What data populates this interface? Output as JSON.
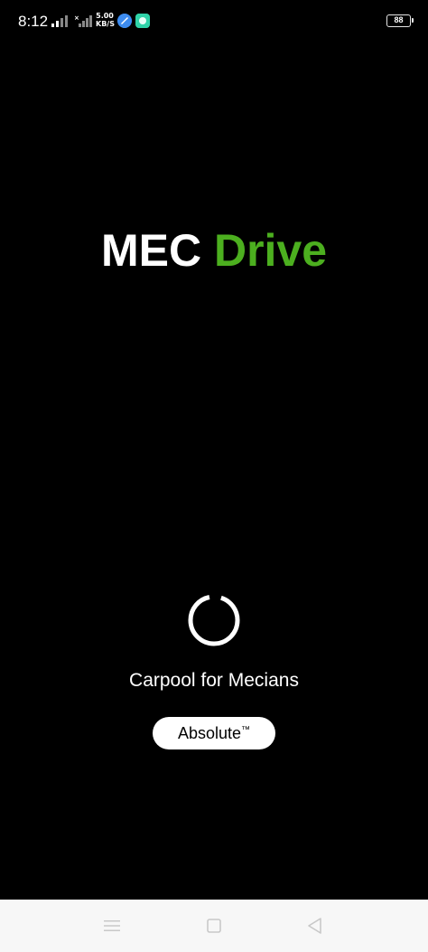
{
  "status_bar": {
    "time": "8:12",
    "net_speed_value": "5.00",
    "net_speed_unit": "KB/S",
    "battery": "88"
  },
  "splash": {
    "logo_part1": "MEC",
    "logo_part2": "Drive",
    "tagline": "Carpool for Mecians",
    "badge_text": "Absolute",
    "badge_mark": "™"
  },
  "colors": {
    "background": "#000000",
    "brand_green": "#4caf1f",
    "nav_bar": "#f7f7f7"
  },
  "icons": {
    "nav": [
      "menu-icon",
      "home-icon",
      "back-icon"
    ]
  }
}
